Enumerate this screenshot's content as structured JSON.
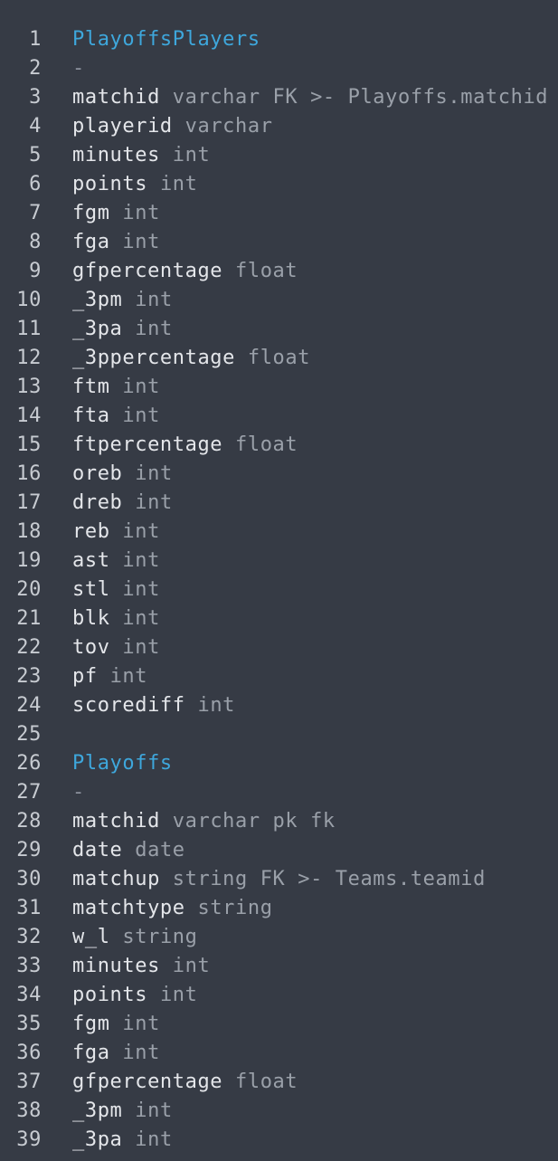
{
  "editor": {
    "lines": [
      {
        "n": "1",
        "kind": "table",
        "text": "PlayoffsPlayers"
      },
      {
        "n": "2",
        "kind": "sep",
        "text": "-"
      },
      {
        "n": "3",
        "kind": "col",
        "name": "matchid",
        "type": "varchar FK >- Playoffs.matchid"
      },
      {
        "n": "4",
        "kind": "col",
        "name": "playerid",
        "type": "varchar"
      },
      {
        "n": "5",
        "kind": "col",
        "name": "minutes",
        "type": "int"
      },
      {
        "n": "6",
        "kind": "col",
        "name": "points",
        "type": "int"
      },
      {
        "n": "7",
        "kind": "col",
        "name": "fgm",
        "type": "int"
      },
      {
        "n": "8",
        "kind": "col",
        "name": "fga",
        "type": "int"
      },
      {
        "n": "9",
        "kind": "col",
        "name": "gfpercentage",
        "type": "float"
      },
      {
        "n": "10",
        "kind": "col",
        "name": "_3pm",
        "type": "int"
      },
      {
        "n": "11",
        "kind": "col",
        "name": "_3pa",
        "type": "int"
      },
      {
        "n": "12",
        "kind": "col",
        "name": "_3ppercentage",
        "type": "float"
      },
      {
        "n": "13",
        "kind": "col",
        "name": "ftm",
        "type": "int"
      },
      {
        "n": "14",
        "kind": "col",
        "name": "fta",
        "type": "int"
      },
      {
        "n": "15",
        "kind": "col",
        "name": "ftpercentage",
        "type": "float"
      },
      {
        "n": "16",
        "kind": "col",
        "name": "oreb",
        "type": "int"
      },
      {
        "n": "17",
        "kind": "col",
        "name": "dreb",
        "type": "int"
      },
      {
        "n": "18",
        "kind": "col",
        "name": "reb",
        "type": "int"
      },
      {
        "n": "19",
        "kind": "col",
        "name": "ast",
        "type": "int"
      },
      {
        "n": "20",
        "kind": "col",
        "name": "stl",
        "type": "int"
      },
      {
        "n": "21",
        "kind": "col",
        "name": "blk",
        "type": "int"
      },
      {
        "n": "22",
        "kind": "col",
        "name": "tov",
        "type": "int"
      },
      {
        "n": "23",
        "kind": "col",
        "name": "pf",
        "type": "int"
      },
      {
        "n": "24",
        "kind": "col",
        "name": "scorediff",
        "type": "int"
      },
      {
        "n": "25",
        "kind": "blank",
        "text": ""
      },
      {
        "n": "26",
        "kind": "table",
        "text": "Playoffs"
      },
      {
        "n": "27",
        "kind": "sep",
        "text": "-"
      },
      {
        "n": "28",
        "kind": "col",
        "name": "matchid",
        "type": "varchar pk fk"
      },
      {
        "n": "29",
        "kind": "col",
        "name": "date",
        "type": "date"
      },
      {
        "n": "30",
        "kind": "col",
        "name": "matchup",
        "type": "string FK >- Teams.teamid"
      },
      {
        "n": "31",
        "kind": "col",
        "name": "matchtype",
        "type": "string"
      },
      {
        "n": "32",
        "kind": "col",
        "name": "w_l",
        "type": "string"
      },
      {
        "n": "33",
        "kind": "col",
        "name": "minutes",
        "type": "int"
      },
      {
        "n": "34",
        "kind": "col",
        "name": "points",
        "type": "int"
      },
      {
        "n": "35",
        "kind": "col",
        "name": "fgm",
        "type": "int"
      },
      {
        "n": "36",
        "kind": "col",
        "name": "fga",
        "type": "int"
      },
      {
        "n": "37",
        "kind": "col",
        "name": "gfpercentage",
        "type": "float"
      },
      {
        "n": "38",
        "kind": "col",
        "name": "_3pm",
        "type": "int"
      },
      {
        "n": "39",
        "kind": "col",
        "name": "_3pa",
        "type": "int"
      }
    ]
  }
}
